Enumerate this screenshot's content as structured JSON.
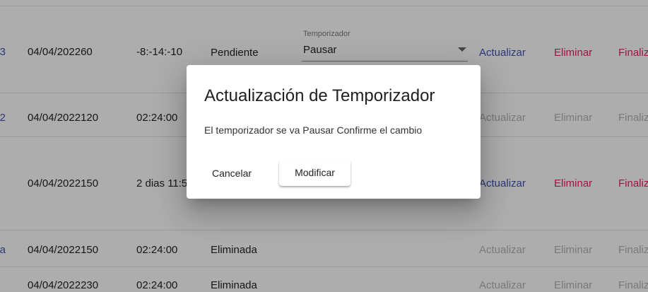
{
  "rows": [
    {
      "cut": "3",
      "date": "04/04/202260",
      "time": "-8:-14:-10",
      "status": "Pendiente",
      "actions": {
        "update": "Actualizar",
        "delete": "Eliminar",
        "finish": "Finaliz"
      }
    },
    {
      "cut": "2",
      "date": "04/04/2022120",
      "time": "02:24:00",
      "status": "",
      "actions": {
        "update": "Actualizar",
        "delete": "Eliminar",
        "finish": "Finaliz"
      }
    },
    {
      "cut": "",
      "date": "04/04/2022150",
      "time": "2 dias 11:5",
      "status": "",
      "actions": {
        "update": "Actualizar",
        "delete": "Eliminar",
        "finish": "Finaliz"
      }
    },
    {
      "cut": "a",
      "date": "04/04/2022150",
      "time": "02:24:00",
      "status": "Eliminada",
      "actions": {
        "update": "Actualizar",
        "delete": "Eliminar",
        "finish": "Finaliz"
      }
    },
    {
      "cut": "",
      "date": "04/04/2022230",
      "time": "02:24:00",
      "status": "Eliminada",
      "actions": {
        "update": "Actualizar",
        "delete": "Eliminar",
        "finish": "Finaliz"
      }
    }
  ],
  "timer_select": {
    "label": "Temporizador",
    "value": "Pausar"
  },
  "dialog": {
    "title": "Actualización de Temporizador",
    "message": "El temporizador se va Pausar Confirme el cambio",
    "cancel_label": "Cancelar",
    "confirm_label": "Modificar"
  },
  "colors": {
    "link_blue": "#3f51b5",
    "accent_pink": "#e91e63",
    "disabled_gray": "#b3b3b3",
    "backdrop": "rgba(0,0,0,0.32)"
  }
}
